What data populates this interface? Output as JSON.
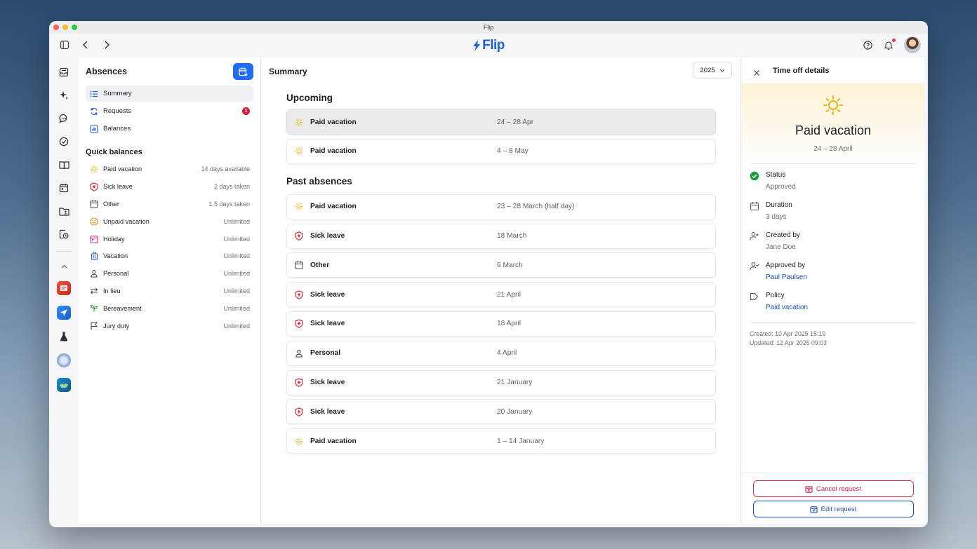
{
  "window": {
    "title": "Flip"
  },
  "toolbar": {
    "logo_text": "Flip",
    "brand_color": "#1f5fe0"
  },
  "rail": {
    "nav_icons": [
      "inbox-icon",
      "sparkles-icon",
      "chat-icon",
      "check-circle-icon",
      "book-icon",
      "calendar-icon",
      "folder-user-icon",
      "clock-document-icon"
    ],
    "app_icons": [
      "app-red",
      "app-blue-plane",
      "app-flask",
      "app-globe",
      "app-teal"
    ]
  },
  "sidebar": {
    "title": "Absences",
    "nav": [
      {
        "label": "Summary",
        "icon": "list-icon",
        "active": true
      },
      {
        "label": "Requests",
        "icon": "sync-icon",
        "badge": "1"
      },
      {
        "label": "Balances",
        "icon": "chart-icon"
      }
    ],
    "quick_balances_title": "Quick balances",
    "quick_balances": [
      {
        "label": "Paid vacation",
        "value": "14 days available",
        "icon": "sun-icon"
      },
      {
        "label": "Sick leave",
        "value": "2 days taken",
        "icon": "shield-plus-icon"
      },
      {
        "label": "Other",
        "value": "1.5 days taken",
        "icon": "calendar-icon"
      },
      {
        "label": "Unpaid vacation",
        "value": "Unlimited",
        "icon": "smile-icon"
      },
      {
        "label": "Holiday",
        "value": "Unlimited",
        "icon": "calendar-pink-icon"
      },
      {
        "label": "Vacation",
        "value": "Unlimited",
        "icon": "luggage-icon"
      },
      {
        "label": "Personal",
        "value": "Unlimited",
        "icon": "person-icon"
      },
      {
        "label": "In lieu",
        "value": "Unlimited",
        "icon": "swap-icon"
      },
      {
        "label": "Bereavement",
        "value": "Unlimited",
        "icon": "sprout-icon"
      },
      {
        "label": "Jury duty",
        "value": "Unlimited",
        "icon": "flag-icon"
      }
    ]
  },
  "main": {
    "title": "Summary",
    "year": "2025",
    "upcoming_title": "Upcoming",
    "upcoming": [
      {
        "type": "Paid vacation",
        "date": "24 – 28 Apr",
        "icon": "sun-icon",
        "selected": true
      },
      {
        "type": "Paid vacation",
        "date": "4 – 8 May",
        "icon": "sun-icon"
      }
    ],
    "past_title": "Past absences",
    "past": [
      {
        "type": "Paid vacation",
        "date": "23 – 28 March (half day)",
        "icon": "sun-icon"
      },
      {
        "type": "Sick leave",
        "date": "18 March",
        "icon": "shield-plus-icon"
      },
      {
        "type": "Other",
        "date": "6 March",
        "icon": "calendar-icon"
      },
      {
        "type": "Sick leave",
        "date": "21 April",
        "icon": "shield-plus-icon"
      },
      {
        "type": "Sick leave",
        "date": "18 April",
        "icon": "shield-plus-icon"
      },
      {
        "type": "Personal",
        "date": "4 April",
        "icon": "person-icon"
      },
      {
        "type": "Sick leave",
        "date": "21 January",
        "icon": "shield-plus-icon"
      },
      {
        "type": "Sick leave",
        "date": "20 January",
        "icon": "shield-plus-icon"
      },
      {
        "type": "Paid vacation",
        "date": "1 – 14 January",
        "icon": "sun-icon"
      }
    ]
  },
  "details": {
    "title": "Time off details",
    "absence_type": "Paid vacation",
    "date_range": "24 – 28 April",
    "fields": [
      {
        "label": "Status",
        "value": "Approved",
        "icon": "check-circle-icon",
        "link": false
      },
      {
        "label": "Duration",
        "value": "3 days",
        "icon": "calendar-icon",
        "link": false
      },
      {
        "label": "Created by",
        "value": "Jane Doe",
        "icon": "person-add-icon",
        "link": false
      },
      {
        "label": "Approved by",
        "value": "Paul Paulsen",
        "icon": "person-check-icon",
        "link": true
      },
      {
        "label": "Policy",
        "value": "Paid vacation",
        "icon": "tag-icon",
        "link": true
      }
    ],
    "created": "Created: 10 Apr 2025 15:19",
    "updated": "Updated: 12 Apr 2025 09:03",
    "cancel_label": "Cancel request",
    "edit_label": "Edit request"
  }
}
